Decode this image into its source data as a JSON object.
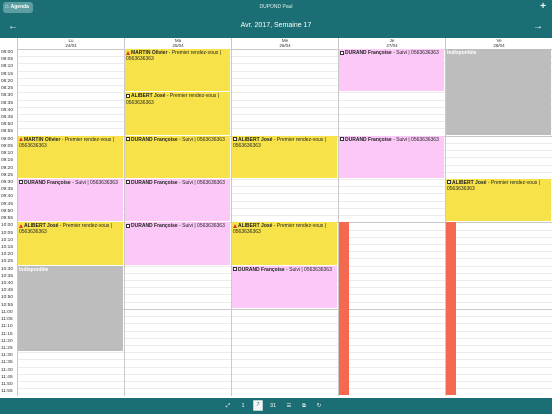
{
  "top_bar": {
    "agenda_label": "Agenda",
    "title": "DUPOND Paul",
    "plus_label": "+"
  },
  "nav": {
    "prev": "←",
    "next": "→",
    "week_title": "Avr. 2017, Semaine 17"
  },
  "days": [
    {
      "name": "Lu",
      "date": "24/04"
    },
    {
      "name": "Ma",
      "date": "25/04"
    },
    {
      "name": "Me",
      "date": "26/04"
    },
    {
      "name": "Je",
      "date": "27/04"
    },
    {
      "name": "Ve",
      "date": "28/04"
    }
  ],
  "times": [
    "08:00",
    "08:05",
    "08:10",
    "08:15",
    "08:20",
    "08:25",
    "08:30",
    "08:35",
    "08:40",
    "08:45",
    "08:50",
    "08:55",
    "09:00",
    "09:05",
    "09:10",
    "09:15",
    "09:20",
    "09:25",
    "09:30",
    "09:35",
    "09:40",
    "09:45",
    "09:50",
    "09:55",
    "10:00",
    "10:05",
    "10:10",
    "10:15",
    "10:20",
    "10:25",
    "10:30",
    "10:35",
    "10:40",
    "10:45",
    "10:50",
    "10:55",
    "11:00",
    "11:05",
    "11:10",
    "11:15",
    "11:20",
    "11:25",
    "11:30",
    "11:35",
    "11:40",
    "11:45",
    "11:50",
    "11:55"
  ],
  "events": [
    {
      "day": 1,
      "start": 0,
      "dur": 6,
      "color": "yellow",
      "icon": "warn",
      "name": "MARTIN Olivier",
      "text": " - Premier rendez-vous | 0563636363"
    },
    {
      "day": 1,
      "start": 6,
      "dur": 6,
      "color": "yellow",
      "icon": "person",
      "name": "ALIBERT José",
      "text": " - Premier rendez-vous | 0563636363"
    },
    {
      "day": 0,
      "start": 12,
      "dur": 6,
      "color": "yellow",
      "icon": "warn",
      "name": "MARTIN Olivier",
      "text": " - Premier rendez-vous | 0563636363"
    },
    {
      "day": 1,
      "start": 12,
      "dur": 6,
      "color": "yellow",
      "icon": "person",
      "name": "DURAND Françoise",
      "text": " - Suivi | 0563636363"
    },
    {
      "day": 2,
      "start": 12,
      "dur": 6,
      "color": "yellow",
      "icon": "person",
      "name": "ALIBERT José",
      "text": " - Premier rendez-vous | 0563636363"
    },
    {
      "day": 3,
      "start": 12,
      "dur": 6,
      "color": "pink",
      "icon": "person",
      "name": "DURAND Françoise",
      "text": " - Suivi | 0563636363"
    },
    {
      "day": 3,
      "start": 0,
      "dur": 6,
      "color": "pink",
      "icon": "person",
      "name": "DURAND Françoise",
      "text": " - Suivi | 0563636363"
    },
    {
      "day": 0,
      "start": 18,
      "dur": 6,
      "color": "pink",
      "icon": "person",
      "name": "DURAND Françoise",
      "text": " - Suivi | 0563636363"
    },
    {
      "day": 1,
      "start": 18,
      "dur": 6,
      "color": "pink",
      "icon": "person",
      "name": "DURAND Françoise",
      "text": " - Suivi | 0563636363"
    },
    {
      "day": 4,
      "start": 18,
      "dur": 6,
      "color": "yellow",
      "icon": "person",
      "name": "ALIBERT José",
      "text": " - Premier rendez-vous | 0563636363"
    },
    {
      "day": 0,
      "start": 24,
      "dur": 6,
      "color": "yellow",
      "icon": "warn",
      "name": "ALIBERT José",
      "text": " - Premier rendez-vous | 0563636363"
    },
    {
      "day": 1,
      "start": 24,
      "dur": 6,
      "color": "pink",
      "icon": "person",
      "name": "DURAND Françoise",
      "text": " - Suivi | 0563636363"
    },
    {
      "day": 2,
      "start": 24,
      "dur": 6,
      "color": "yellow",
      "icon": "warn",
      "name": "ALIBERT José",
      "text": " - Premier rendez-vous | 0563636363"
    },
    {
      "day": 2,
      "start": 30,
      "dur": 6,
      "color": "pink",
      "icon": "person",
      "name": "DURAND Françoise",
      "text": " - Suivi | 0563636363"
    },
    {
      "day": 0,
      "start": 30,
      "dur": 12,
      "color": "grey",
      "icon": "",
      "name": "",
      "text": "Indisponible"
    },
    {
      "day": 4,
      "start": 0,
      "dur": 12,
      "color": "grey",
      "icon": "",
      "name": "",
      "text": "Indisponible"
    }
  ],
  "red_bars": [
    {
      "day": 3,
      "start": 24,
      "dur": 24
    },
    {
      "day": 4,
      "start": 24,
      "dur": 24
    }
  ],
  "toolbar": {
    "expand": "⤢",
    "day_view": "1",
    "week_view": "7",
    "month_view": "31",
    "list_view": "☰",
    "export": "⧉",
    "refresh": "↻"
  }
}
